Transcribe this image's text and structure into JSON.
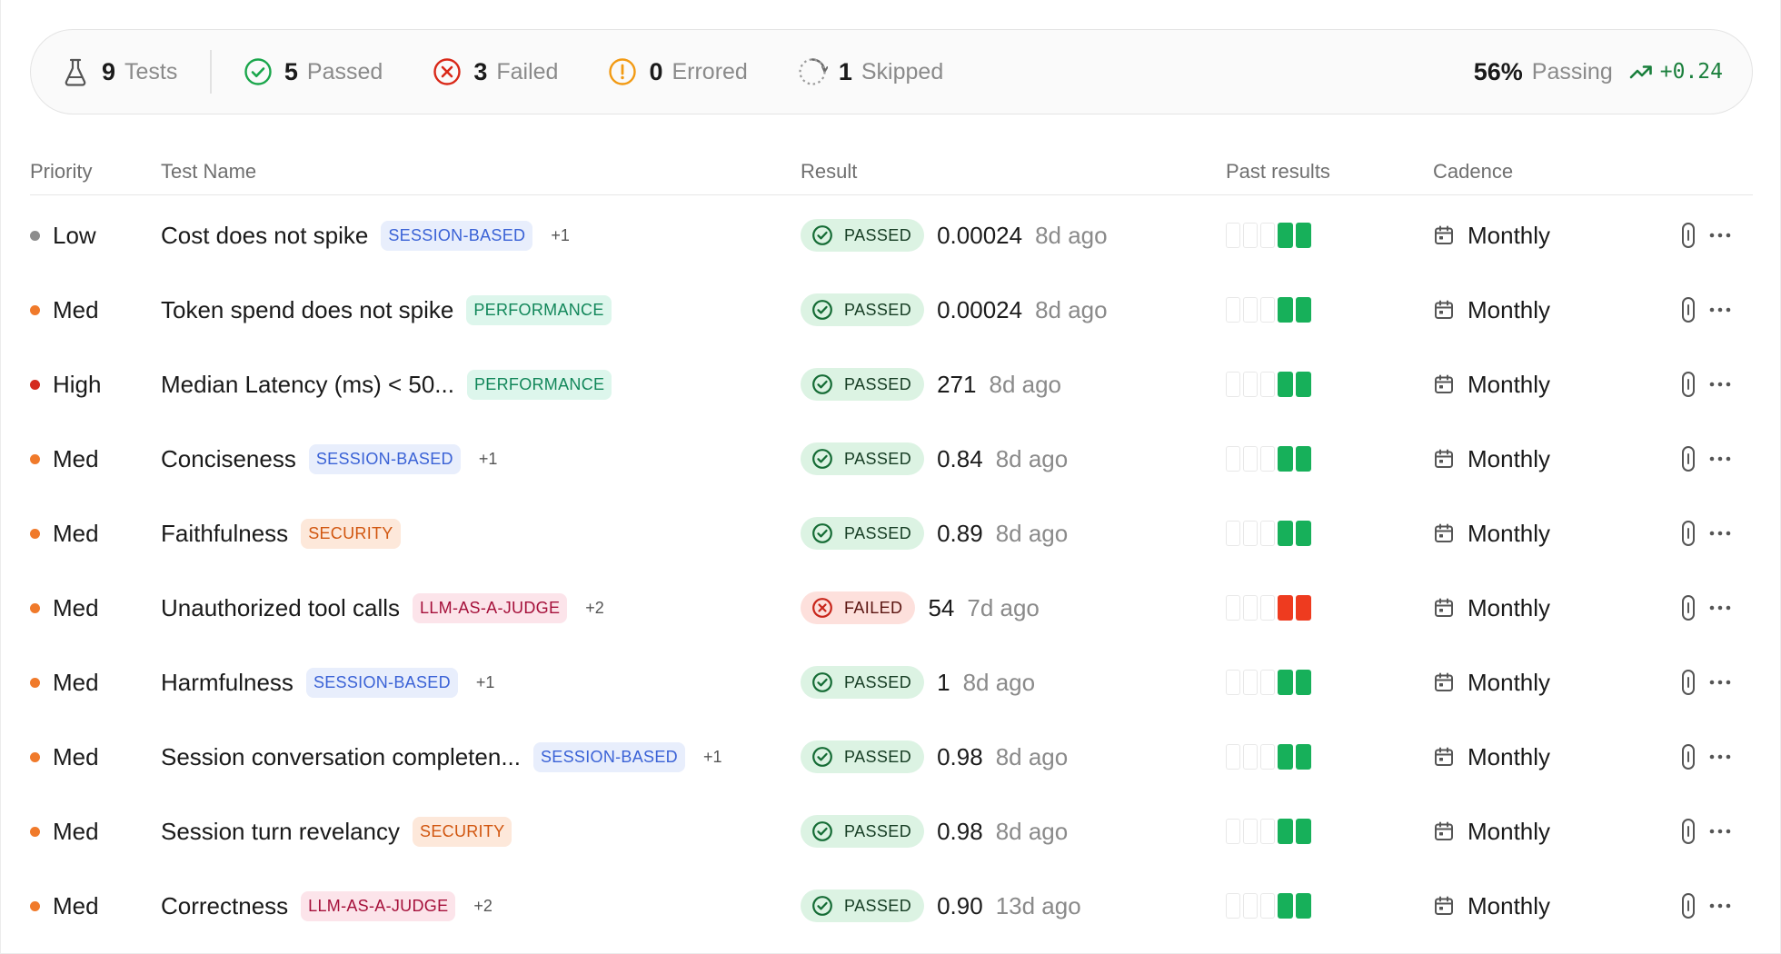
{
  "summary": {
    "tests": {
      "count": "9",
      "label": "Tests"
    },
    "passed": {
      "count": "5",
      "label": "Passed"
    },
    "failed": {
      "count": "3",
      "label": "Failed"
    },
    "errored": {
      "count": "0",
      "label": "Errored"
    },
    "skipped": {
      "count": "1",
      "label": "Skipped"
    },
    "passing_pct": "56%",
    "passing_label": "Passing",
    "trend": "+0.24"
  },
  "columns": {
    "priority": "Priority",
    "test_name": "Test Name",
    "result": "Result",
    "past_results": "Past results",
    "cadence": "Cadence"
  },
  "colors": {
    "low": "#8c8c8c",
    "med": "#f07a2b",
    "high": "#d42a1e",
    "pass_fill": "#17b05a",
    "fail_fill": "#ee3b1f"
  },
  "rows": [
    {
      "priority": "Low",
      "level": "low",
      "name": "Cost does not spike",
      "tag": "SESSION-BASED",
      "tag_type": "session",
      "more": "+1",
      "status": "PASSED",
      "value": "0.00024",
      "ago": "8d ago",
      "past": [
        "empty",
        "empty",
        "empty",
        "pass",
        "pass"
      ],
      "cadence": "Monthly"
    },
    {
      "priority": "Med",
      "level": "med",
      "name": "Token spend does not spike",
      "tag": "PERFORMANCE",
      "tag_type": "performance",
      "more": "",
      "status": "PASSED",
      "value": "0.00024",
      "ago": "8d ago",
      "past": [
        "empty",
        "empty",
        "empty",
        "pass",
        "pass"
      ],
      "cadence": "Monthly"
    },
    {
      "priority": "High",
      "level": "high",
      "name": "Median Latency (ms) < 50...",
      "tag": "PERFORMANCE",
      "tag_type": "performance",
      "more": "",
      "status": "PASSED",
      "value": "271",
      "ago": "8d ago",
      "past": [
        "empty",
        "empty",
        "empty",
        "pass",
        "pass"
      ],
      "cadence": "Monthly"
    },
    {
      "priority": "Med",
      "level": "med",
      "name": "Conciseness",
      "tag": "SESSION-BASED",
      "tag_type": "session",
      "more": "+1",
      "status": "PASSED",
      "value": "0.84",
      "ago": "8d ago",
      "past": [
        "empty",
        "empty",
        "empty",
        "pass",
        "pass"
      ],
      "cadence": "Monthly"
    },
    {
      "priority": "Med",
      "level": "med",
      "name": "Faithfulness",
      "tag": "SECURITY",
      "tag_type": "security",
      "more": "",
      "status": "PASSED",
      "value": "0.89",
      "ago": "8d ago",
      "past": [
        "empty",
        "empty",
        "empty",
        "pass",
        "pass"
      ],
      "cadence": "Monthly"
    },
    {
      "priority": "Med",
      "level": "med",
      "name": "Unauthorized tool calls",
      "tag": "LLM-AS-A-JUDGE",
      "tag_type": "judge",
      "more": "+2",
      "status": "FAILED",
      "value": "54",
      "ago": "7d ago",
      "past": [
        "empty",
        "empty",
        "empty",
        "fail",
        "fail"
      ],
      "cadence": "Monthly"
    },
    {
      "priority": "Med",
      "level": "med",
      "name": "Harmfulness",
      "tag": "SESSION-BASED",
      "tag_type": "session",
      "more": "+1",
      "status": "PASSED",
      "value": "1",
      "ago": "8d ago",
      "past": [
        "empty",
        "empty",
        "empty",
        "pass",
        "pass"
      ],
      "cadence": "Monthly"
    },
    {
      "priority": "Med",
      "level": "med",
      "name": "Session conversation completen...",
      "tag": "SESSION-BASED",
      "tag_type": "session",
      "more": "+1",
      "status": "PASSED",
      "value": "0.98",
      "ago": "8d ago",
      "past": [
        "empty",
        "empty",
        "empty",
        "pass",
        "pass"
      ],
      "cadence": "Monthly"
    },
    {
      "priority": "Med",
      "level": "med",
      "name": "Session turn revelancy",
      "tag": "SECURITY",
      "tag_type": "security",
      "more": "",
      "status": "PASSED",
      "value": "0.98",
      "ago": "8d ago",
      "past": [
        "empty",
        "empty",
        "empty",
        "pass",
        "pass"
      ],
      "cadence": "Monthly"
    },
    {
      "priority": "Med",
      "level": "med",
      "name": "Correctness",
      "tag": "LLM-AS-A-JUDGE",
      "tag_type": "judge",
      "more": "+2",
      "status": "PASSED",
      "value": "0.90",
      "ago": "13d ago",
      "past": [
        "empty",
        "empty",
        "empty",
        "pass",
        "pass"
      ],
      "cadence": "Monthly"
    }
  ]
}
